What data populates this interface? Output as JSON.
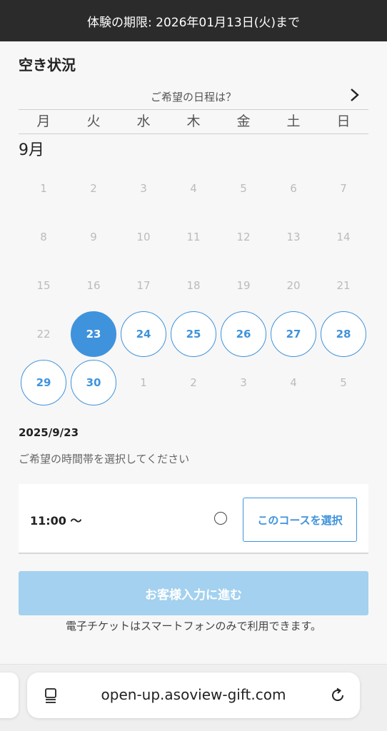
{
  "banner": {
    "text": "体験の期限: 2026年01月13日(火)まで"
  },
  "section": {
    "title": "空き状況"
  },
  "calendar": {
    "nav_label": "ご希望の日程は？",
    "next_icon": "chevron-right-icon",
    "weekdays": [
      "月",
      "火",
      "水",
      "木",
      "金",
      "土",
      "日"
    ],
    "month_label": "9月",
    "accent_color": "#3f93dc",
    "days": [
      {
        "label": "1",
        "state": "disabled"
      },
      {
        "label": "2",
        "state": "disabled"
      },
      {
        "label": "3",
        "state": "disabled"
      },
      {
        "label": "4",
        "state": "disabled"
      },
      {
        "label": "5",
        "state": "disabled"
      },
      {
        "label": "6",
        "state": "disabled"
      },
      {
        "label": "7",
        "state": "disabled"
      },
      {
        "label": "8",
        "state": "disabled"
      },
      {
        "label": "9",
        "state": "disabled"
      },
      {
        "label": "10",
        "state": "disabled"
      },
      {
        "label": "11",
        "state": "disabled"
      },
      {
        "label": "12",
        "state": "disabled"
      },
      {
        "label": "13",
        "state": "disabled"
      },
      {
        "label": "14",
        "state": "disabled"
      },
      {
        "label": "15",
        "state": "disabled"
      },
      {
        "label": "16",
        "state": "disabled"
      },
      {
        "label": "17",
        "state": "disabled"
      },
      {
        "label": "18",
        "state": "disabled"
      },
      {
        "label": "19",
        "state": "disabled"
      },
      {
        "label": "20",
        "state": "disabled"
      },
      {
        "label": "21",
        "state": "disabled"
      },
      {
        "label": "22",
        "state": "disabled"
      },
      {
        "label": "23",
        "state": "selected"
      },
      {
        "label": "24",
        "state": "available"
      },
      {
        "label": "25",
        "state": "available"
      },
      {
        "label": "26",
        "state": "available"
      },
      {
        "label": "27",
        "state": "available"
      },
      {
        "label": "28",
        "state": "available"
      },
      {
        "label": "29",
        "state": "available"
      },
      {
        "label": "30",
        "state": "available"
      },
      {
        "label": "1",
        "state": "disabled"
      },
      {
        "label": "2",
        "state": "disabled"
      },
      {
        "label": "3",
        "state": "disabled"
      },
      {
        "label": "4",
        "state": "disabled"
      },
      {
        "label": "5",
        "state": "disabled"
      }
    ]
  },
  "selection": {
    "date": "2025/9/23",
    "instruction": "ご希望の時間帯を選択してください"
  },
  "slot": {
    "time": "11:00 〜",
    "availability_mark": "〇",
    "select_label": "このコースを選択"
  },
  "proceed": {
    "label": "お客様入力に進む",
    "color": "#a3d1ef"
  },
  "note": "電子チケットはスマートフォンのみで利用できます。",
  "browser": {
    "url": "open-up.asoview-gift.com",
    "menu_icon": "reader-icon",
    "reload_icon": "reload-icon"
  }
}
